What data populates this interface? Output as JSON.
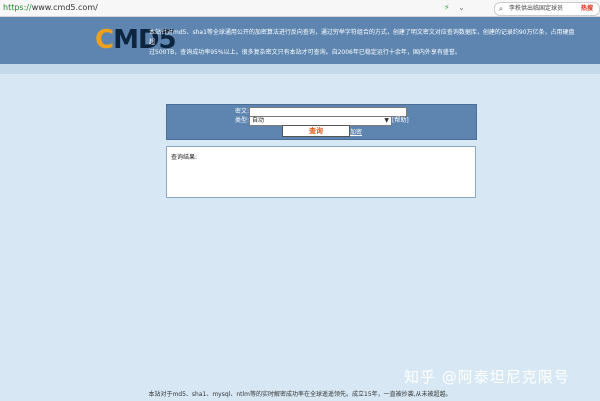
{
  "browser": {
    "url_scheme": "https://",
    "url_host": "www.cmd5.com/",
    "search_query": "李秩供出临国定球员",
    "hot_badge": "热搜"
  },
  "header": {
    "logo_c": "C",
    "logo_rest": "MD5",
    "intro_line1": "本站针对md5、sha1等全球通用公开的加密算法进行反向查询，通过穷举字符组合的方式，创建了明文密文对应查询数据库，创建的记录约90万亿条，占用硬盘超",
    "intro_line2": "过500TB，查询成功率95%以上。很多复杂密文只有本站才可查询。自2006年已稳定运行十余年，国内外享有盛誉。"
  },
  "form": {
    "cipher_label": "密文:",
    "cipher_value": "",
    "type_label": "类型:",
    "type_value": "自动",
    "help_link": "[帮助]",
    "query_button": "查询",
    "encrypt_link": "加密"
  },
  "result": {
    "label": "查询结果:"
  },
  "watermark": "知乎 @阿泰坦尼克限号",
  "footer": "本站对于md5、sha1、mysql、ntlm等的实时解密成功率在全球遥遥领先。成立15年，一直被抄袭,从未被超越。"
}
